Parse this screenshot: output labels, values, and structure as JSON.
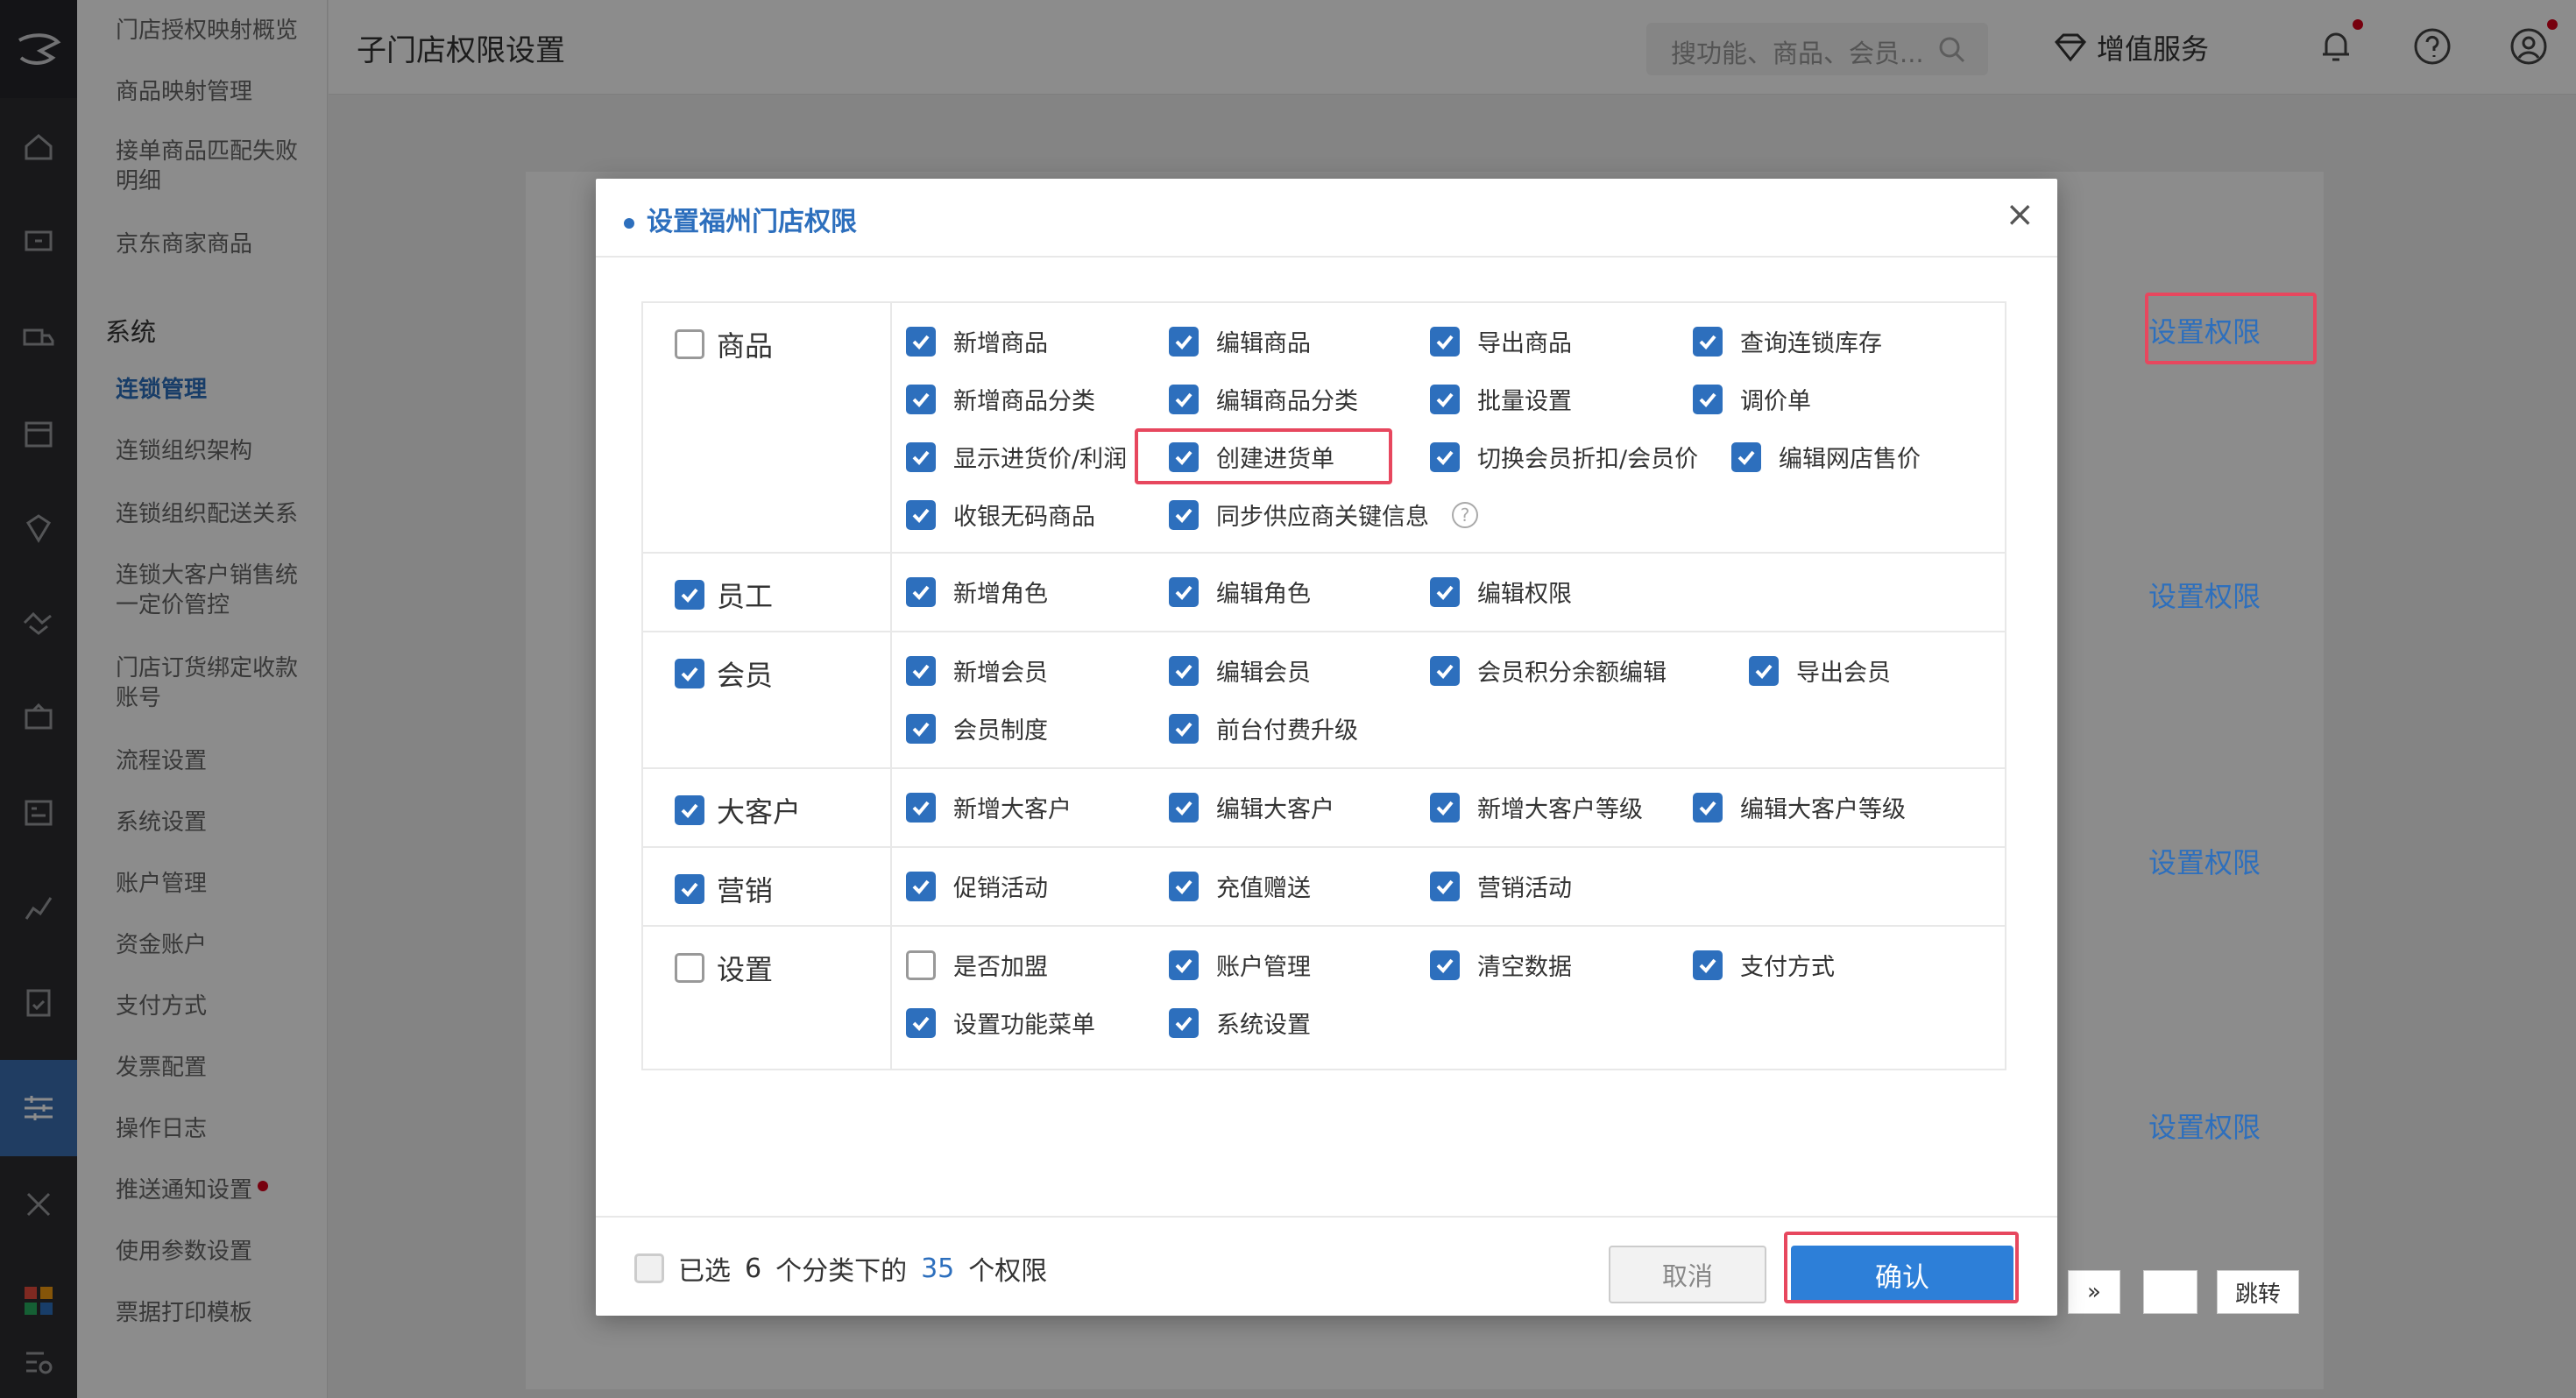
{
  "topbar": {
    "title": "子门店权限设置",
    "search_placeholder": "搜功能、商品、会员...",
    "vip_label": "增值服务"
  },
  "sidebar": {
    "items_top": [
      "门店授权映射概览",
      "商品映射管理",
      "接单商品匹配失败明细",
      "京东商家商品"
    ],
    "section": "系统",
    "items": [
      "连锁管理",
      "连锁组织架构",
      "连锁组织配送关系",
      "连锁大客户销售统一定价管控",
      "门店订货绑定收款账号",
      "流程设置",
      "系统设置",
      "账户管理",
      "资金账户",
      "支付方式",
      "发票配置",
      "操作日志",
      "推送通知设置",
      "使用参数设置",
      "票据打印模板"
    ],
    "current": "连锁管理"
  },
  "background": {
    "set_perm_label": "设置权限",
    "jump_label": "跳转",
    "next_label": "»"
  },
  "modal": {
    "title": "设置福州门店权限",
    "close": "×",
    "categories": [
      {
        "name": "商品",
        "checked": false,
        "perms": [
          {
            "label": "新增商品",
            "checked": true
          },
          {
            "label": "编辑商品",
            "checked": true
          },
          {
            "label": "导出商品",
            "checked": true
          },
          {
            "label": "查询连锁库存",
            "checked": true
          },
          {
            "label": "新增商品分类",
            "checked": true
          },
          {
            "label": "编辑商品分类",
            "checked": true
          },
          {
            "label": "批量设置",
            "checked": true
          },
          {
            "label": "调价单",
            "checked": true
          },
          {
            "label": "显示进货价/利润",
            "checked": true
          },
          {
            "label": "创建进货单",
            "checked": true
          },
          {
            "label": "切换会员折扣/会员价",
            "checked": true
          },
          {
            "label": "编辑网店售价",
            "checked": true
          },
          {
            "label": "收银无码商品",
            "checked": true
          },
          {
            "label": "同步供应商关键信息",
            "checked": true
          }
        ]
      },
      {
        "name": "员工",
        "checked": true,
        "perms": [
          {
            "label": "新增角色",
            "checked": true
          },
          {
            "label": "编辑角色",
            "checked": true
          },
          {
            "label": "编辑权限",
            "checked": true
          }
        ]
      },
      {
        "name": "会员",
        "checked": true,
        "perms": [
          {
            "label": "新增会员",
            "checked": true
          },
          {
            "label": "编辑会员",
            "checked": true
          },
          {
            "label": "会员积分余额编辑",
            "checked": true
          },
          {
            "label": "导出会员",
            "checked": true
          },
          {
            "label": "会员制度",
            "checked": true
          },
          {
            "label": "前台付费升级",
            "checked": true
          }
        ]
      },
      {
        "name": "大客户",
        "checked": true,
        "perms": [
          {
            "label": "新增大客户",
            "checked": true
          },
          {
            "label": "编辑大客户",
            "checked": true
          },
          {
            "label": "新增大客户等级",
            "checked": true
          },
          {
            "label": "编辑大客户等级",
            "checked": true
          }
        ]
      },
      {
        "name": "营销",
        "checked": true,
        "perms": [
          {
            "label": "促销活动",
            "checked": true
          },
          {
            "label": "充值赠送",
            "checked": true
          },
          {
            "label": "营销活动",
            "checked": true
          }
        ]
      },
      {
        "name": "设置",
        "checked": false,
        "perms": [
          {
            "label": "是否加盟",
            "checked": false
          },
          {
            "label": "账户管理",
            "checked": true
          },
          {
            "label": "清空数据",
            "checked": true
          },
          {
            "label": "支付方式",
            "checked": true
          },
          {
            "label": "设置功能菜单",
            "checked": true
          },
          {
            "label": "系统设置",
            "checked": true
          }
        ]
      }
    ],
    "footer": {
      "prefix": "已选",
      "cat_count": "6",
      "middle": "个分类下的",
      "perm_count": "35",
      "suffix": "个权限",
      "cancel": "取消",
      "confirm": "确认"
    }
  },
  "colors": {
    "accent": "#2d6fbd",
    "highlight": "#e7475e",
    "confirm": "#2d7fd8"
  }
}
